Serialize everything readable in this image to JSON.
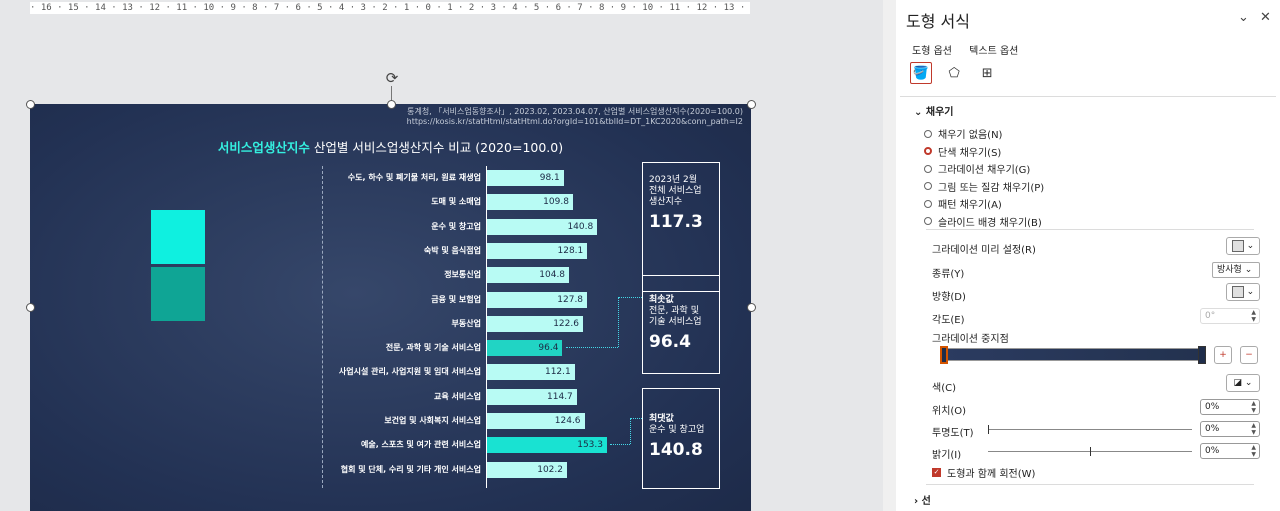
{
  "ruler": {
    "text": "· 16 · 15 · 14 · 13 · 12 · 11 · 10 · 9 · 8 · 7 · 6 · 5 · 4 · 3 · 2 · 1 · 0 · 1 · 2 · 3 · 4 · 5 · 6 · 7 · 8 · 9 · 10 · 11 · 12 · 13 · 14 · 15 · 16 ·"
  },
  "slide": {
    "source_line1": "통계청, 「서비스업동향조사」, 2023.02, 2023.04.07, 산업별 서비스업생산지수(2020=100.0)",
    "source_line2": "https://kosis.kr/statHtml/statHtml.do?orgId=101&tblId=DT_1KC2020&conn_path=I2",
    "title_highlight": "서비스업생산지수",
    "title_rest": " 산업별 서비스업생산지수 비교 (2020=100.0)",
    "square_colors": [
      "#0ff0e0",
      "#0fa595"
    ],
    "box_total": {
      "line1": "2023년 2월",
      "line2": "전체 서비스업",
      "line3": "생산지수",
      "value": "117.3"
    },
    "box_min": {
      "label": "최솟값",
      "line1": "전문, 과학 및",
      "line2": "기술 서비스업",
      "value": "96.4"
    },
    "box_max": {
      "label": "최댓값",
      "line1": "운수 및 창고업",
      "value": "140.8"
    }
  },
  "chart_data": {
    "type": "bar",
    "orientation": "horizontal",
    "categories": [
      "수도, 하수 및 폐기물 처리, 원료 재생업",
      "도매 및 소매업",
      "운수 및 창고업",
      "숙박 및 음식점업",
      "정보통신업",
      "금융 및 보험업",
      "부동산업",
      "전문, 과학 및 기술 서비스업",
      "사업시설 관리, 사업지원 및 임대 서비스업",
      "교육 서비스업",
      "보건업 및 사회복지 서비스업",
      "예술, 스포츠 및 여가 관련 서비스업",
      "협회 및 단체, 수리 및 기타 개인 서비스업"
    ],
    "values": [
      98.1,
      109.8,
      140.8,
      128.1,
      104.8,
      127.8,
      122.6,
      96.4,
      112.1,
      114.7,
      124.6,
      153.3,
      102.2
    ],
    "value_labels": [
      "98.1",
      "109.8",
      "140.8",
      "128.1",
      "104.8",
      "127.8",
      "122.6",
      "96.4",
      "112.1",
      "114.7",
      "124.6",
      "153.3",
      "102.2"
    ],
    "highlight_min_index": 7,
    "highlight_max_index": 11,
    "colors": {
      "bar": "#b8fbf4",
      "min": "#21d4c4",
      "max": "#19e2d2"
    },
    "xlim": [
      0,
      160
    ]
  },
  "panel": {
    "title": "도형 서식",
    "tab_shape": "도형 옵션",
    "tab_text": "텍스트 옵션",
    "section_fill": "채우기",
    "fill_options": [
      "채우기 없음(N)",
      "단색 채우기(S)",
      "그라데이션 채우기(G)",
      "그림 또는 질감 채우기(P)",
      "패턴 채우기(A)",
      "슬라이드 배경 채우기(B)"
    ],
    "fill_selected": 1,
    "preset_label": "그라데이션 미리 설정(R)",
    "type_label": "종류(Y)",
    "type_value": "방사형",
    "direction_label": "방향(D)",
    "angle_label": "각도(E)",
    "angle_value": "0°",
    "stops_label": "그라데이션 중지점",
    "color_label": "색(C)",
    "position_label": "위치(O)",
    "position_value": "0%",
    "transparency_label": "투명도(T)",
    "transparency_value": "0%",
    "brightness_label": "밝기(I)",
    "brightness_value": "0%",
    "transparency_level": 0,
    "brightness_level": 0.5,
    "rotate_label": "도형과 함께 회전(W)",
    "section_line": "선",
    "accent": "#c0392b"
  }
}
